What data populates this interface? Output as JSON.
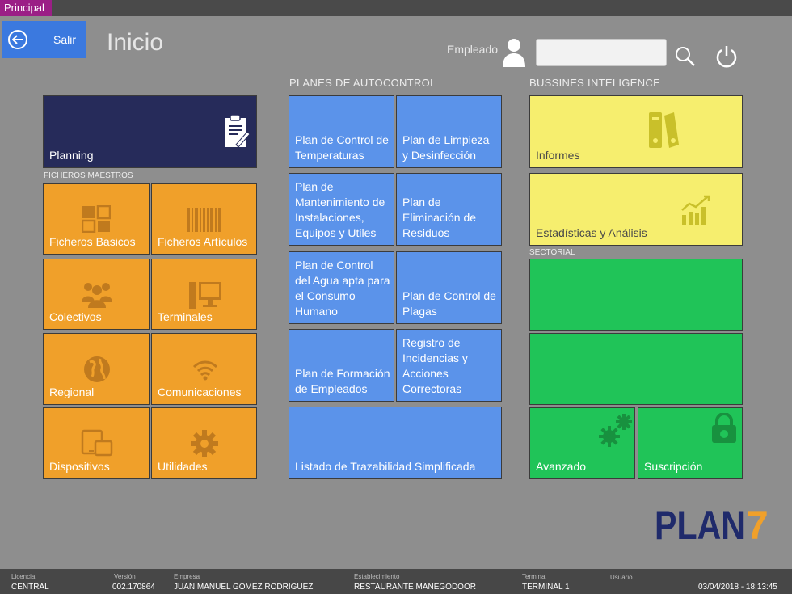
{
  "window": {
    "tab": "Principal"
  },
  "header": {
    "exit_label": "Salir",
    "title": "Inicio",
    "employee_label": "Empleado",
    "employee_value": ""
  },
  "sections": {
    "ficheros": "FICHEROS MAESTROS",
    "planes": "PLANES DE AUTOCONTROL",
    "bi": "BUSSINES INTELIGENCE",
    "sectorial": "SECTORIAL"
  },
  "tiles": {
    "planning": "Planning",
    "ficheros_basicos": "Ficheros Basicos",
    "ficheros_articulos": "Ficheros  Artículos",
    "colectivos": "Colectivos",
    "terminales": "Terminales",
    "regional": "Regional",
    "comunicaciones": "Comunicaciones",
    "dispositivos": "Dispositivos",
    "utilidades": "Utilidades",
    "plan_temperaturas": "Plan de Control de Temperaturas",
    "plan_limpieza": "Plan de Limpieza y Desinfección",
    "plan_mantenimiento": "Plan de Mantenimiento de Instalaciones, Equipos y Utiles",
    "plan_residuos": "Plan de Eliminación de Residuos",
    "plan_agua": "Plan de Control del Agua apta para el Consumo Humano",
    "plan_plagas": "Plan de Control de Plagas",
    "plan_formacion": "Plan de Formación de Empleados",
    "registro_incidencias": "Registro de Incidencias y Acciones Correctoras",
    "listado_trazabilidad": "Listado de Trazabilidad Simplificada",
    "informes": "Informes",
    "estadisticas": "Estadísticas y Análisis",
    "avanzado": "Avanzado",
    "suscripcion": "Suscripción"
  },
  "logo": {
    "text": "PLAN",
    "digit": "7"
  },
  "status": {
    "licencia_cap": "Licencia",
    "licencia": "CENTRAL",
    "version_cap": "Versión",
    "version": "002.170864",
    "empresa_cap": "Empresa",
    "empresa": "JUAN MANUEL GOMEZ RODRIGUEZ",
    "establecimiento_cap": "Establecimiento",
    "establecimiento": "RESTAURANTE MANEGODOOR",
    "terminal_cap": "Terminal",
    "terminal": "TERMINAL 1",
    "usuario_cap": "Usuario",
    "usuario": "",
    "datetime": "03/04/2018  -  18:13:45"
  },
  "colors": {
    "orange": "#f0a02a",
    "blue": "#5b93ea",
    "yellow": "#f6ee6e",
    "green": "#20c458",
    "navy": "#262b5a",
    "logo_blue": "#1f2a6b",
    "logo_orange": "#f0a02a"
  }
}
